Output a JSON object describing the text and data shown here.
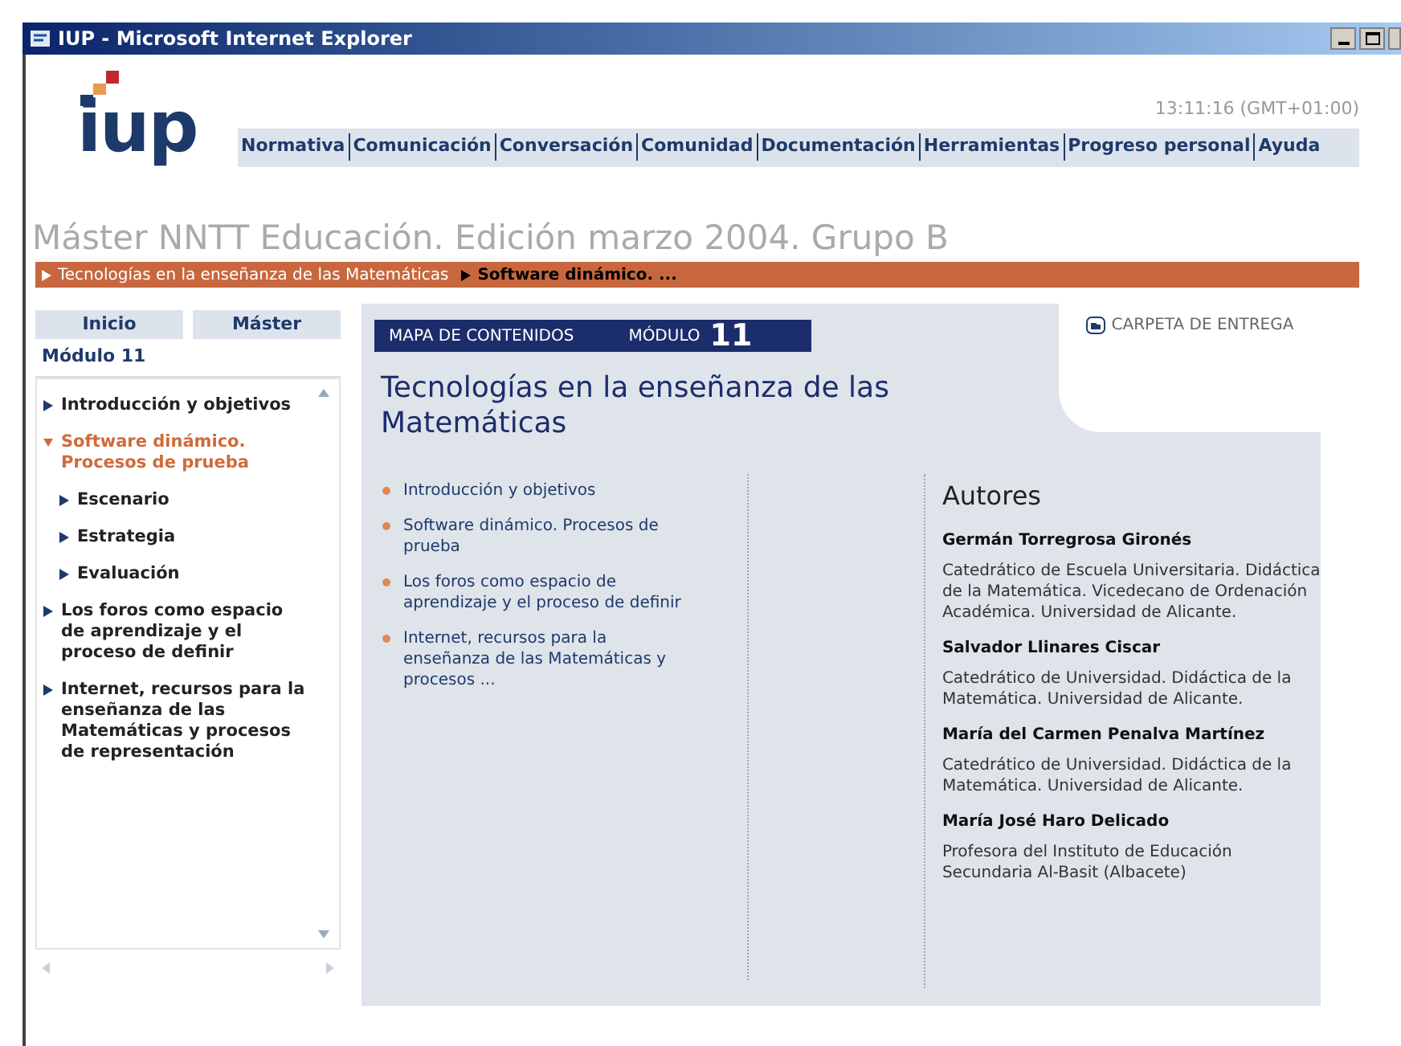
{
  "window": {
    "title": "IUP - Microsoft Internet Explorer"
  },
  "header": {
    "logo_text": "iup",
    "time": "13:11:16 (GMT+01:00)",
    "nav": [
      "Normativa",
      "Comunicación",
      "Conversación",
      "Comunidad",
      "Documentación",
      "Herramientas",
      "Progreso personal",
      "Ayuda"
    ]
  },
  "course_title": "Máster NNTT Educación. Edición marzo 2004. Grupo B",
  "breadcrumb": [
    {
      "label": "Tecnologías en la enseñanza de las Matemáticas",
      "current": false
    },
    {
      "label": "Software dinámico. ...",
      "current": true
    }
  ],
  "sidebar": {
    "tabs": [
      "Inicio",
      "Máster"
    ],
    "module": "Módulo 11",
    "items": [
      {
        "label": "Introducción y objetivos",
        "expanded": false,
        "selected": false
      },
      {
        "label": "Software dinámico. Procesos de prueba",
        "expanded": true,
        "selected": true,
        "children": [
          {
            "label": "Escenario",
            "expanded": false,
            "selected": false
          },
          {
            "label": "Estrategia",
            "expanded": false,
            "selected": false
          },
          {
            "label": "Evaluación",
            "expanded": false,
            "selected": false
          }
        ]
      },
      {
        "label": "Los foros como espacio de aprendizaje y el proceso de definir",
        "expanded": false,
        "selected": false
      },
      {
        "label": "Internet, recursos para la enseñanza de las Matemáticas y procesos de representación",
        "expanded": false,
        "selected": false
      }
    ]
  },
  "main": {
    "map_label": "MAPA DE CONTENIDOS",
    "module_label": "MÓDULO",
    "module_number": "11",
    "delivery_folder": "CARPETA DE ENTREGA",
    "title": "Tecnologías en la enseñanza de las Matemáticas",
    "contents": [
      "Introducción y objetivos",
      "Software dinámico. Procesos de prueba",
      "Los foros como espacio de aprendizaje y el proceso de definir",
      "Internet, recursos para la enseñanza de las Matemáticas y procesos ..."
    ],
    "authors_heading": "Autores",
    "authors": [
      {
        "name": "Germán Torregrosa Gironés",
        "description": "Catedrático de Escuela Universitaria. Didáctica de la Matemática. Vicedecano de Ordenación Académica. Universidad de Alicante."
      },
      {
        "name": "Salvador Llinares Ciscar",
        "description": "Catedrático de Universidad. Didáctica de la Matemática. Universidad de Alicante."
      },
      {
        "name": "María del Carmen Penalva Martínez",
        "description": "Catedrático de Universidad. Didáctica de la Matemática. Universidad de Alicante."
      },
      {
        "name": "María José Haro Delicado",
        "description": "Profesora del Instituto de Educación Secundaria Al-Basit (Albacete)"
      }
    ]
  }
}
